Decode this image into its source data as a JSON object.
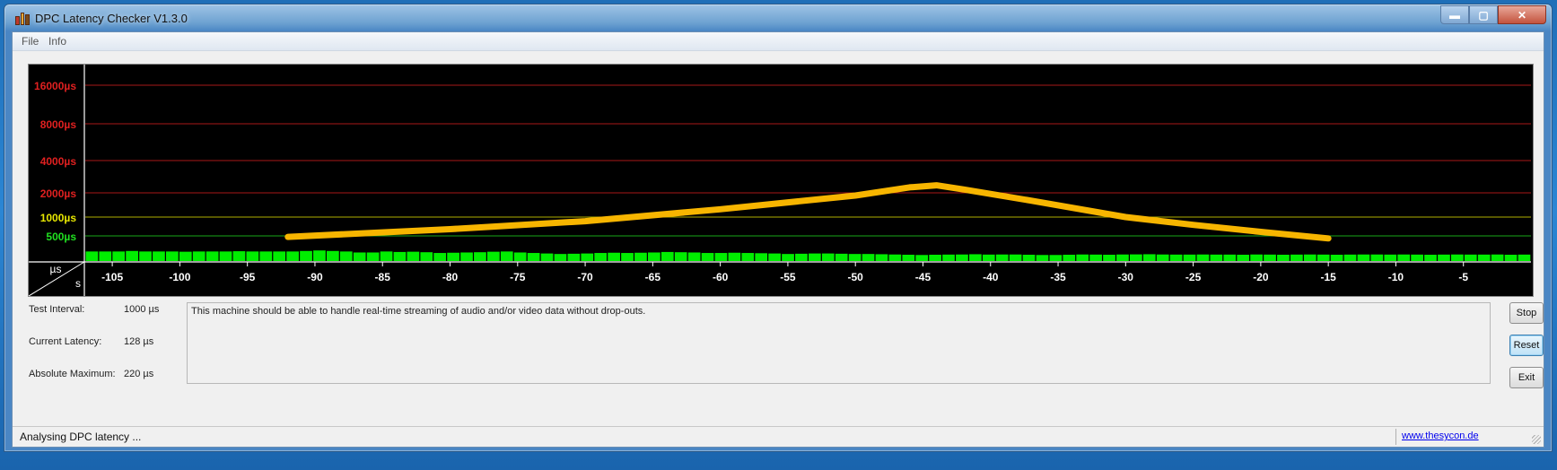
{
  "window": {
    "title": "DPC Latency Checker V1.3.0",
    "controls": {
      "minimize": "▬",
      "maximize": "▢",
      "close": "✕"
    }
  },
  "menu": {
    "items": [
      "File",
      "Info"
    ]
  },
  "chart_data": {
    "type": "bar",
    "title": "",
    "xlabel": "s",
    "ylabel": "µs",
    "x_ticks": [
      -105,
      -100,
      -95,
      -90,
      -85,
      -80,
      -75,
      -70,
      -65,
      -60,
      -55,
      -50,
      -45,
      -40,
      -35,
      -30,
      -25,
      -20,
      -15,
      -10,
      -5
    ],
    "y_ticks": [
      {
        "label": "16000µs",
        "value": 16000,
        "color": "#e02020"
      },
      {
        "label": "8000µs",
        "value": 8000,
        "color": "#e02020"
      },
      {
        "label": "4000µs",
        "value": 4000,
        "color": "#e02020"
      },
      {
        "label": "2000µs",
        "value": 2000,
        "color": "#e02020"
      },
      {
        "label": "1000µs",
        "value": 1000,
        "color": "#e8e800"
      },
      {
        "label": "500µs",
        "value": 500,
        "color": "#20e020"
      }
    ],
    "bar_color": "#00ee00",
    "x_range": [
      -107,
      0
    ],
    "values": [
      190,
      190,
      190,
      200,
      190,
      190,
      190,
      185,
      190,
      190,
      190,
      195,
      190,
      190,
      190,
      190,
      200,
      210,
      200,
      190,
      170,
      170,
      190,
      180,
      185,
      175,
      160,
      165,
      170,
      175,
      185,
      190,
      170,
      160,
      150,
      140,
      145,
      150,
      160,
      165,
      160,
      165,
      170,
      180,
      175,
      170,
      160,
      160,
      165,
      160,
      155,
      150,
      140,
      145,
      150,
      150,
      145,
      140,
      140,
      135,
      130,
      125,
      120,
      125,
      128,
      130,
      135,
      128,
      130,
      130,
      125,
      120,
      120,
      125,
      130,
      128,
      125,
      130,
      132,
      135,
      130,
      128,
      128,
      130,
      128,
      128,
      125,
      130,
      128,
      125,
      128,
      130,
      128,
      125,
      128,
      130,
      130,
      128,
      130,
      128,
      125,
      128,
      130,
      128,
      128,
      130,
      125,
      128
    ],
    "overlay_color": "#f7b500",
    "overlay": [
      [
        -92,
        480
      ],
      [
        -80,
        640
      ],
      [
        -70,
        860
      ],
      [
        -60,
        1250
      ],
      [
        -50,
        1850
      ],
      [
        -46,
        2250
      ],
      [
        -44,
        2350
      ],
      [
        -42,
        2150
      ],
      [
        -37,
        1600
      ],
      [
        -30,
        1000
      ],
      [
        -25,
        750
      ],
      [
        -20,
        580
      ],
      [
        -15,
        450
      ]
    ]
  },
  "info": {
    "test_interval": {
      "label": "Test Interval:",
      "value": "1000 µs"
    },
    "current_latency": {
      "label": "Current Latency:",
      "value": "128 µs"
    },
    "absolute_maximum": {
      "label": "Absolute Maximum:",
      "value": "220 µs"
    }
  },
  "message": "This machine should be able to handle real-time streaming of audio and/or video data without drop-outs.",
  "buttons": {
    "stop": "Stop",
    "reset": "Reset",
    "exit": "Exit"
  },
  "status": {
    "text": "Analysing DPC latency ...",
    "link": "www.thesycon.de"
  }
}
